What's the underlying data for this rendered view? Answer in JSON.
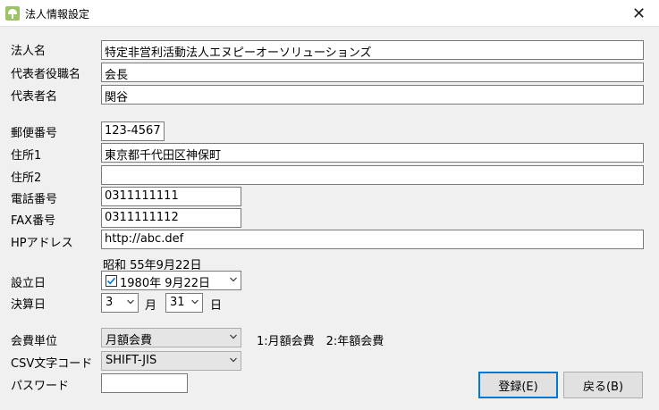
{
  "window": {
    "title": "法人情報設定",
    "close": "✕"
  },
  "labels": {
    "corp_name": "法人名",
    "rep_title": "代表者役職名",
    "rep_name": "代表者名",
    "postal": "郵便番号",
    "address1": "住所1",
    "address2": "住所2",
    "phone": "電話番号",
    "fax": "FAX番号",
    "hp": "HPアドレス",
    "established": "設立日",
    "fiscal": "決算日",
    "fee_unit": "会費単位",
    "csv_code": "CSV文字コード",
    "password": "パスワード"
  },
  "values": {
    "corp_name": "特定非営利活動法人エヌピーオーソリューションズ",
    "rep_title": "会長",
    "rep_name": "関谷",
    "postal": "123-4567",
    "address1": "東京都千代田区神保町",
    "address2": "",
    "phone": "0311111111",
    "fax": "0311111112",
    "hp": "http://abc.def",
    "established_era": "昭和 55年9月22日",
    "established_date": "1980年  9月22日",
    "fiscal_month": "3",
    "fiscal_day": "31",
    "fee_unit": "月額会費",
    "csv_code": "SHIFT-JIS",
    "password": ""
  },
  "static": {
    "month_unit": "月",
    "day_unit": "日",
    "fee_help": "1:月額会費　2:年額会費"
  },
  "buttons": {
    "register": "登録(E)",
    "back": "戻る(B)"
  },
  "colors": {
    "accent": "#0078d7",
    "checkbox_check": "#0078d7"
  }
}
